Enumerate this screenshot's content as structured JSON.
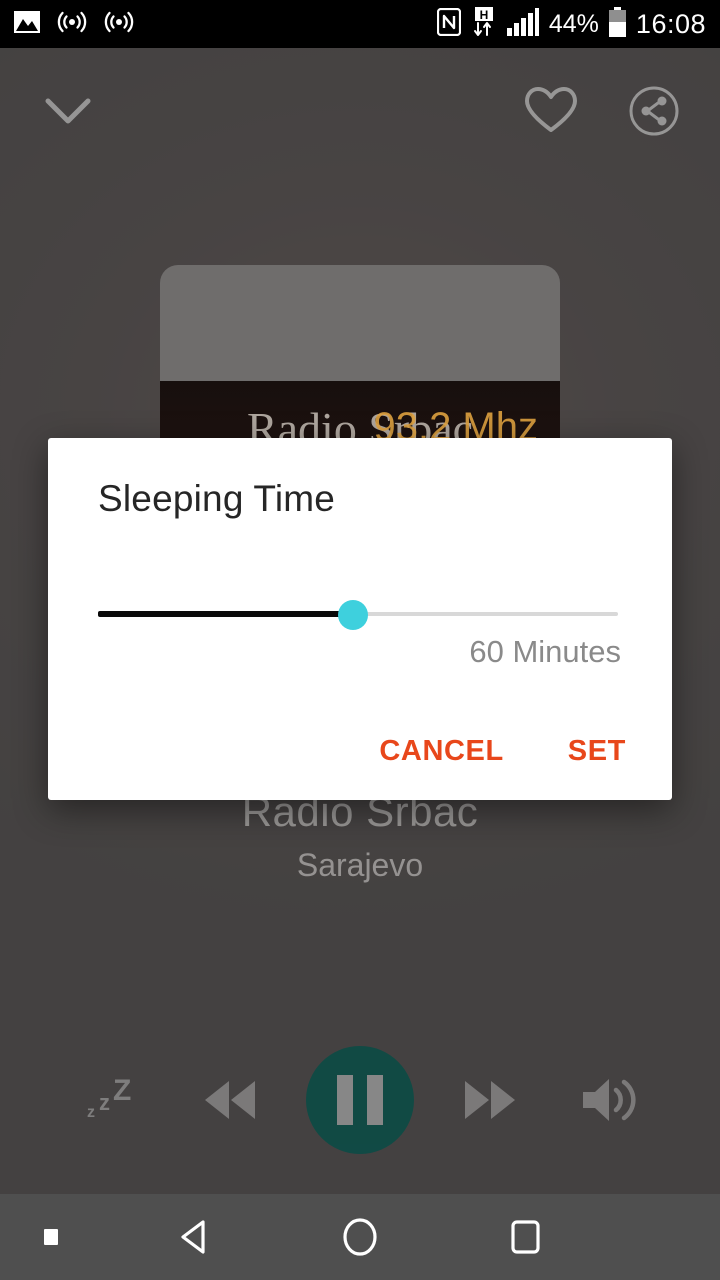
{
  "status_bar": {
    "icons_left": [
      "image-icon",
      "cast-icon",
      "cast-icon-2"
    ],
    "icons_right": [
      "nfc-icon",
      "hsdpa-data-icon",
      "signal-bars-icon",
      "battery-icon"
    ],
    "battery_percent": "44%",
    "clock": "16:08",
    "background_color": "#000000",
    "text_color": "#ffffff"
  },
  "player": {
    "collapse_icon": "chevron-down-icon",
    "favorite_icon": "heart-icon",
    "share_icon": "share-icon",
    "artwork": {
      "logo_text": "Radio Srbac",
      "logo_freq": "93.2 Mhz"
    },
    "station_title": "Radio Srbac",
    "station_subtitle": "Sarajevo",
    "controls": {
      "sleep_timer_icon": "sleep-timer-zzz-icon",
      "rewind_icon": "rewind-icon",
      "play_pause_icon": "pause-icon",
      "play_pause_state": "playing",
      "play_button_color": "#0d4b45",
      "forward_icon": "fast-forward-icon",
      "volume_icon": "volume-up-icon"
    }
  },
  "dialog": {
    "title": "Sleeping Time",
    "slider": {
      "value": 60,
      "min": 0,
      "max": 120,
      "percent": 49,
      "thumb_color": "#3ed0dd",
      "filled_track_color": "#0a0a0a",
      "empty_track_color": "#d8d8d8"
    },
    "value_label": "60 Minutes",
    "cancel_label": "CANCEL",
    "set_label": "SET",
    "button_color": "#e8471b",
    "background_color": "#ffffff"
  },
  "nav_bar": {
    "dot_icon": "nav-dot-icon",
    "back_icon": "back-triangle-icon",
    "home_icon": "home-circle-icon",
    "recents_icon": "recents-square-icon",
    "background_color": "#4f4f4f"
  }
}
